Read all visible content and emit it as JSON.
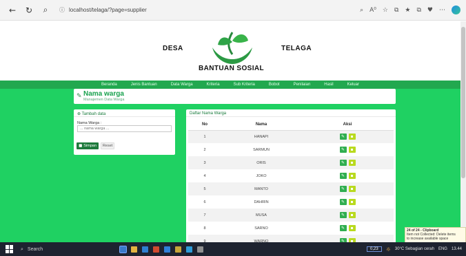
{
  "browser": {
    "url": "localhost/telaga/?page=supplier",
    "back_icon": "←",
    "refresh_icon": "↻",
    "search_icon": "⌕",
    "info_icon": "ⓘ",
    "toolbar_icons": [
      "⌕",
      "A⁰",
      "☆",
      "⧉",
      "★",
      "⧉",
      "♥",
      "⋯"
    ]
  },
  "header": {
    "left_text": "DESA",
    "right_text": "TELAGA",
    "subtitle": "BANTUAN SOSIAL",
    "logo_icon": "hands-sprout-logo"
  },
  "menu": [
    "Beranda",
    "Jenis Bantuan",
    "Data Warga",
    "Kriteria",
    "Sub Kriteria",
    "Bobot",
    "Penilaian",
    "Hasil",
    "Keluar"
  ],
  "page_title": {
    "icon": "✎",
    "title": "Nama warga",
    "subtitle": "Manajemen Data Warga"
  },
  "add_form": {
    "header": "Tambah data",
    "header_icon": "⊕",
    "field_label": "Nama Warga :",
    "placeholder": "... nama warga ...",
    "save_label": "Simpan",
    "reset_label": "Reset"
  },
  "list": {
    "header": "Daftar Nama Warga",
    "columns": [
      "No",
      "Nama",
      "Aksi"
    ],
    "rows": [
      {
        "no": "1",
        "nama": "HANAPI"
      },
      {
        "no": "2",
        "nama": "SARMUN"
      },
      {
        "no": "3",
        "nama": "ORIS"
      },
      {
        "no": "4",
        "nama": "JOKO"
      },
      {
        "no": "5",
        "nama": "MANTO"
      },
      {
        "no": "6",
        "nama": "DAHRIN"
      },
      {
        "no": "7",
        "nama": "MUSA"
      },
      {
        "no": "8",
        "nama": "SARNO"
      },
      {
        "no": "9",
        "nama": "WARNO"
      }
    ],
    "edit_icon": "✎",
    "delete_icon": "▪"
  },
  "notification": {
    "title": "24 of 24 - Clipboard",
    "line1": "Item not Collected: Delete items",
    "line2": "to increase available space"
  },
  "taskbar": {
    "search_label": "Search",
    "search_icon": "⌕",
    "badge": "0,23",
    "weather": "30°C  Sebagian cerah",
    "language": "ENG",
    "time": "13.44",
    "app_colors": [
      "#3a78c8",
      "#e3b341",
      "#2e7fd1",
      "#d04a2f",
      "#2f7fd8",
      "#c7a53a",
      "#2f9bd8",
      "#8f8f8f"
    ]
  },
  "colors": {
    "page_green": "#1fd162",
    "menu_green": "#22a84f",
    "edit_btn": "#2fae4f",
    "delete_btn": "#b9da1f"
  }
}
